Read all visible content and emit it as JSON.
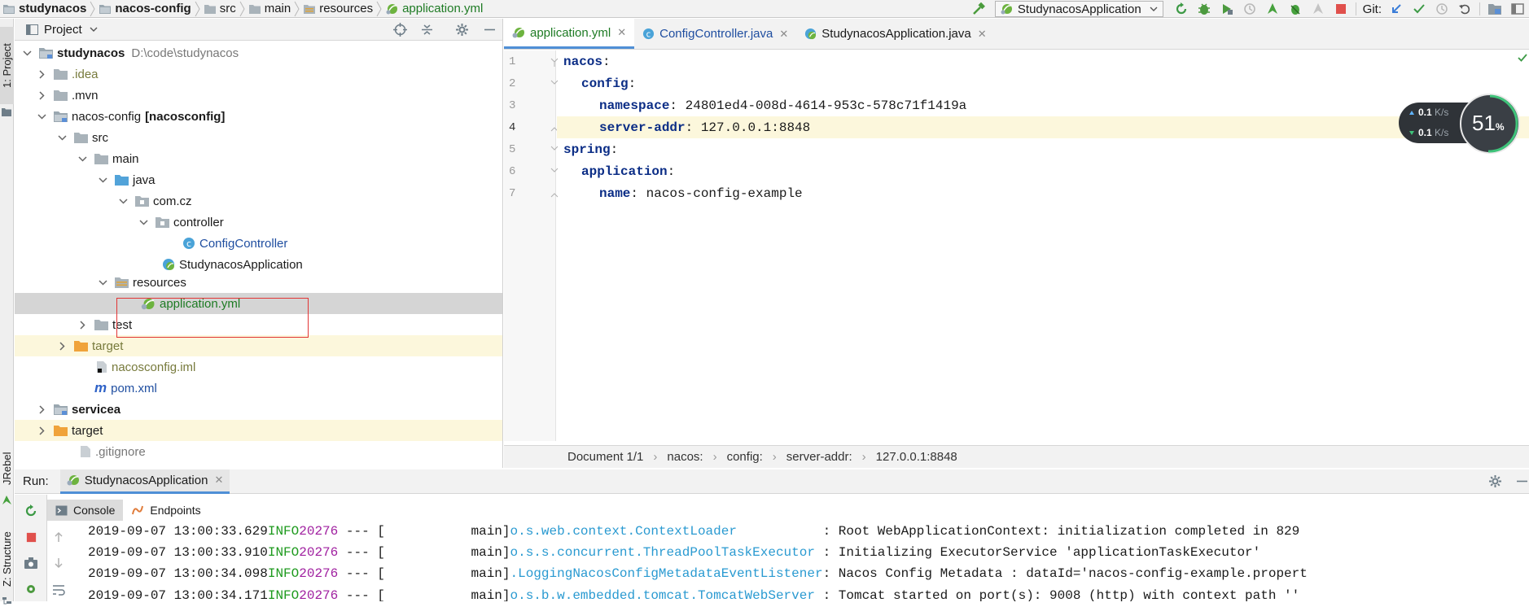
{
  "navbar": {
    "breadcrumbs": [
      "studynacos",
      "nacos-config",
      "src",
      "main",
      "resources",
      "application.yml"
    ],
    "run_config": "StudynacosApplication",
    "git_label": "Git:"
  },
  "left_strip": {
    "project_tab": "1: Project",
    "jrebel_tab": "JRebel",
    "structure_tab": "Z: Structure"
  },
  "project_panel": {
    "title": "Project",
    "tree": [
      {
        "label": "studynacos",
        "extra": "D:\\code\\studynacos"
      },
      {
        "label": ".idea"
      },
      {
        "label": ".mvn"
      },
      {
        "label": "nacos-config",
        "extra": "[nacosconfig]"
      },
      {
        "label": "src"
      },
      {
        "label": "main"
      },
      {
        "label": "java"
      },
      {
        "label": "com.cz"
      },
      {
        "label": "controller"
      },
      {
        "label": "ConfigController"
      },
      {
        "label": "StudynacosApplication"
      },
      {
        "label": "resources"
      },
      {
        "label": "application.yml"
      },
      {
        "label": "test"
      },
      {
        "label": "target"
      },
      {
        "label": "nacosconfig.iml"
      },
      {
        "label": "pom.xml"
      },
      {
        "label": "servicea"
      },
      {
        "label": "target"
      },
      {
        "label": ".gitignore"
      }
    ]
  },
  "editor": {
    "tabs": [
      "application.yml",
      "ConfigController.java",
      "StudynacosApplication.java"
    ],
    "line_numbers": [
      "1",
      "2",
      "3",
      "4",
      "5",
      "6",
      "7"
    ],
    "lines": [
      {
        "key": "nacos",
        "punct": ":",
        "value": ""
      },
      {
        "key": "config",
        "punct": ":",
        "value": ""
      },
      {
        "key": "namespace",
        "punct": ": ",
        "value": "24801ed4-008d-4614-953c-578c71f1419a"
      },
      {
        "key": "server-addr",
        "punct": ": ",
        "value": "127.0.0.1:8848"
      },
      {
        "key": "spring",
        "punct": ":",
        "value": ""
      },
      {
        "key": "application",
        "punct": ":",
        "value": ""
      },
      {
        "key": "name",
        "punct": ": ",
        "value": "nacos-config-example"
      }
    ],
    "status": [
      "Document 1/1",
      "nacos:",
      "config:",
      "server-addr:",
      "127.0.0.1:8848"
    ]
  },
  "netmon": {
    "up": "0.1",
    "down": "0.1",
    "unit": "K/s",
    "percent": "51",
    "percent_sign": "%"
  },
  "run_panel": {
    "label": "Run:",
    "tab": "StudynacosApplication",
    "subtabs": [
      "Console",
      "Endpoints"
    ],
    "log": [
      {
        "ts": "2019-09-07 13:00:33.629",
        "level": "INFO",
        "pid": "20276",
        "sep": " --- [",
        "thread": "           main]",
        "logger": "o.s.web.context.ContextLoader           ",
        "msg": ": Root WebApplicationContext: initialization completed in 829"
      },
      {
        "ts": "2019-09-07 13:00:33.910",
        "level": "INFO",
        "pid": "20276",
        "sep": " --- [",
        "thread": "           main]",
        "logger": "o.s.s.concurrent.ThreadPoolTaskExecutor ",
        "msg": ": Initializing ExecutorService 'applicationTaskExecutor'"
      },
      {
        "ts": "2019-09-07 13:00:34.098",
        "level": "INFO",
        "pid": "20276",
        "sep": " --- [",
        "thread": "           main]",
        "logger": ".LoggingNacosConfigMetadataEventListener",
        "msg": ": Nacos Config Metadata : dataId='nacos-config-example.propert"
      },
      {
        "ts": "2019-09-07 13:00:34.171",
        "level": "INFO",
        "pid": "20276",
        "sep": " --- [",
        "thread": "           main]",
        "logger": "o.s.b.w.embedded.tomcat.TomcatWebServer ",
        "msg": ": Tomcat started on port(s): 9008 (http) with context path ''"
      }
    ]
  }
}
